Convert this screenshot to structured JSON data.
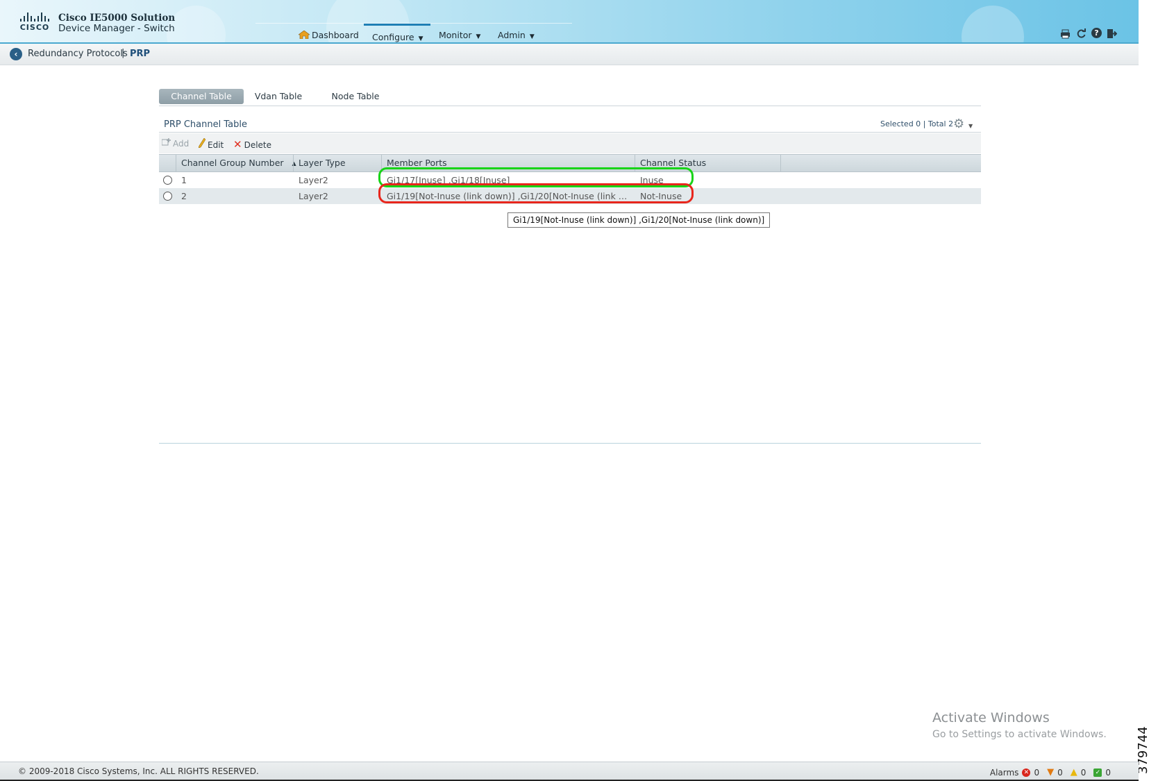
{
  "header": {
    "logo_word": "CISCO",
    "product_name": "Cisco IE5000 Solution",
    "product_sub": "Device Manager - Switch",
    "nav": [
      {
        "label": "Dashboard"
      },
      {
        "label": "Configure"
      },
      {
        "label": "Monitor"
      },
      {
        "label": "Admin"
      }
    ],
    "icons": [
      "print-icon",
      "refresh-icon",
      "help-icon",
      "logout-icon"
    ]
  },
  "breadcrumb": {
    "parent": "Redundancy Protocols",
    "separator": "|",
    "current": "PRP"
  },
  "tabs": [
    {
      "label": "Channel Table",
      "active": true
    },
    {
      "label": "Vdan Table",
      "active": false
    },
    {
      "label": "Node Table",
      "active": false
    }
  ],
  "panel": {
    "title": "PRP Channel Table",
    "selection_info": "Selected 0 | Total 2"
  },
  "toolbar": {
    "add_label": "Add",
    "edit_label": "Edit",
    "delete_label": "Delete"
  },
  "table": {
    "columns": [
      "Channel Group Number",
      "Layer Type",
      "Member Ports",
      "Channel Status"
    ],
    "rows": [
      {
        "group": "1",
        "layer": "Layer2",
        "ports": "Gi1/17[Inuse] ,Gi1/18[Inuse]",
        "status": "Inuse"
      },
      {
        "group": "2",
        "layer": "Layer2",
        "ports": "Gi1/19[Not-Inuse (link down)] ,Gi1/20[Not-Inuse (link dow...",
        "status": "Not-Inuse"
      }
    ]
  },
  "tooltip": "Gi1/19[Not-Inuse (link down)] ,Gi1/20[Not-Inuse (link down)]",
  "watermark": {
    "line1": "Activate Windows",
    "line2": "Go to Settings to activate Windows."
  },
  "figure_id": "379744",
  "footer": {
    "copyright": "© 2009-2018 Cisco Systems, Inc. ALL RIGHTS RESERVED.",
    "alarms_label": "Alarms",
    "critical": "0",
    "major": "0",
    "minor": "0",
    "ok": "0"
  },
  "colors": {
    "accent": "#1f7fb5",
    "inuse_highlight": "#18d418",
    "notinuse_highlight": "#e8261c"
  }
}
